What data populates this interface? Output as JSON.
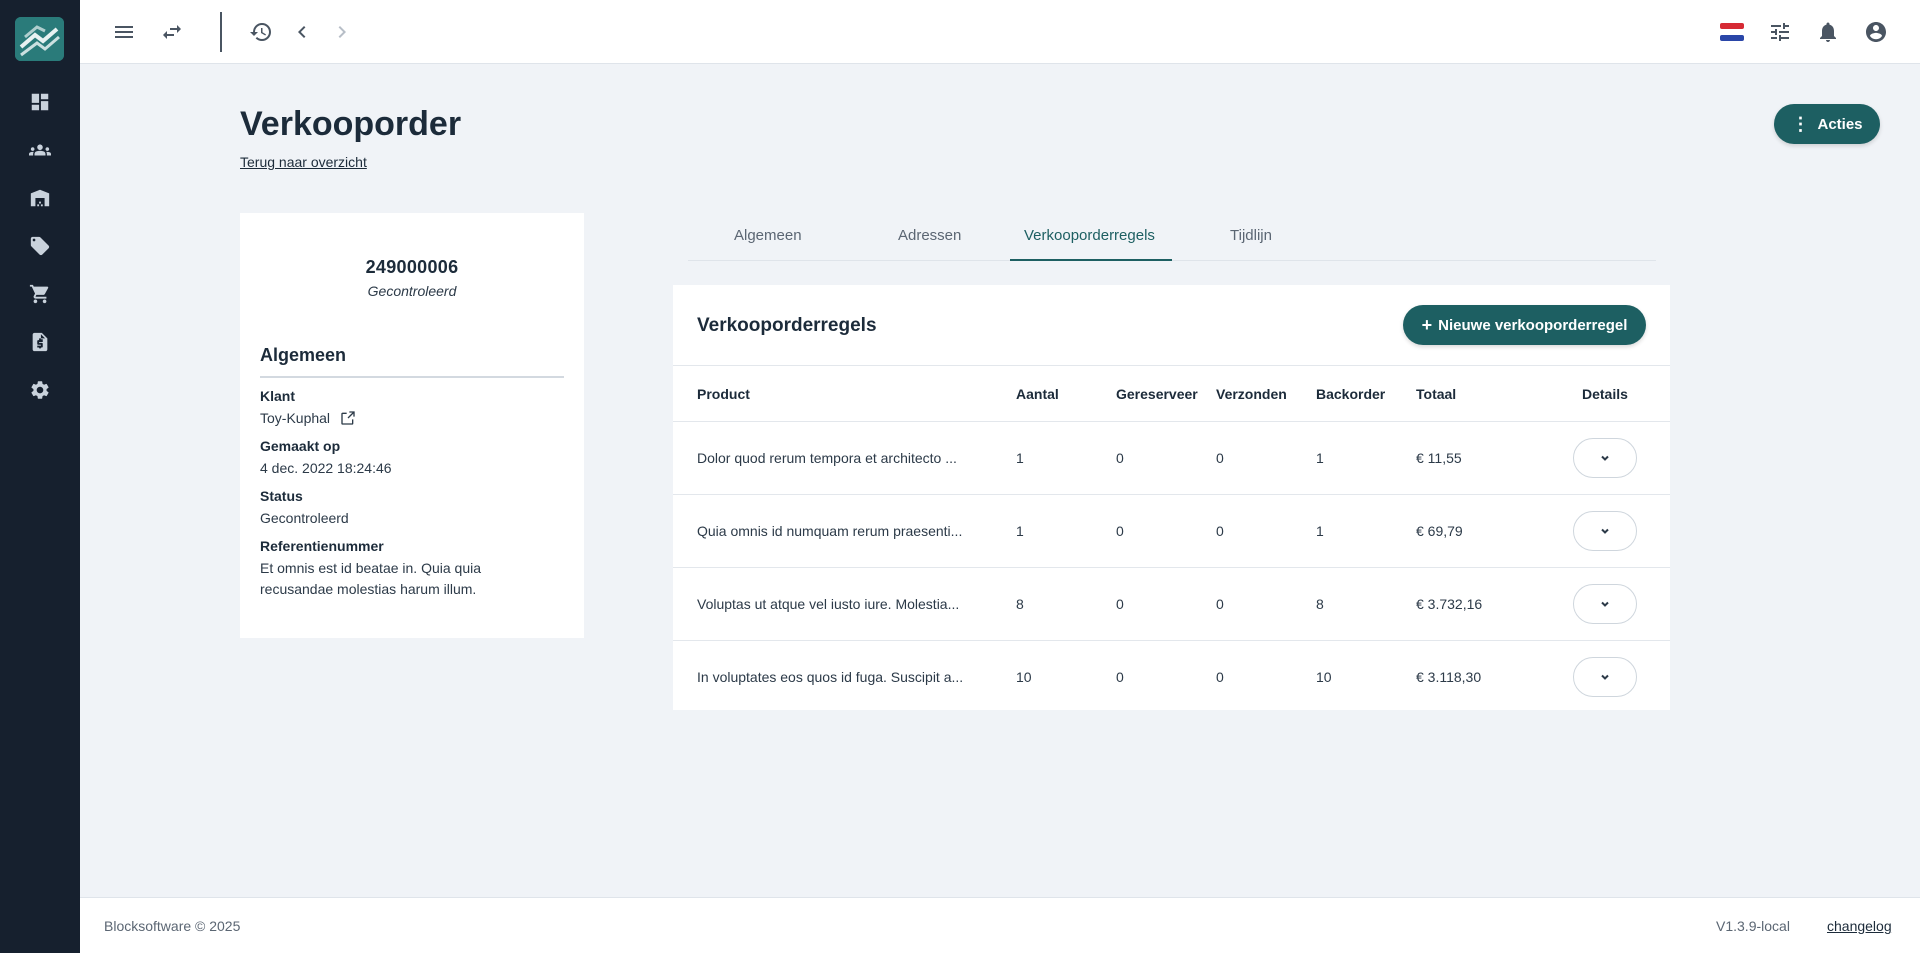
{
  "topbar": {
    "icons": [
      "menu-icon",
      "swap-icon",
      "history-icon",
      "chevron-left-icon",
      "chevron-right-icon",
      "flag-nl-icon",
      "tune-icon",
      "bell-icon",
      "account-icon"
    ]
  },
  "sidebar": {
    "items": [
      "dashboard-icon",
      "users-icon",
      "warehouse-icon",
      "tag-icon",
      "cart-icon",
      "invoice-icon",
      "settings-icon"
    ]
  },
  "header": {
    "title": "Verkooporder",
    "back_link": "Terug naar overzicht",
    "actions_label": "Acties"
  },
  "summary": {
    "order_number": "249000006",
    "status": "Gecontroleerd",
    "section_title": "Algemeen",
    "fields": [
      {
        "label": "Klant",
        "value": "Toy-Kuphal"
      },
      {
        "label": "Gemaakt op",
        "value": "4 dec. 2022 18:24:46"
      },
      {
        "label": "Status",
        "value": "Gecontroleerd"
      },
      {
        "label": "Referentienummer",
        "value": "Et omnis est id beatae in. Quia quia recusandae molestias harum illum."
      }
    ]
  },
  "tabs": [
    {
      "label": "Algemeen"
    },
    {
      "label": "Adressen"
    },
    {
      "label": "Verkooporderregels"
    },
    {
      "label": "Tijdlijn"
    }
  ],
  "lines": {
    "title": "Verkooporderregels",
    "new_button": "Nieuwe verkooporderregel",
    "columns": [
      "Product",
      "Aantal",
      "Gereserveer",
      "Verzonden",
      "Backorder",
      "Totaal",
      "Details"
    ],
    "rows": [
      {
        "product": "Dolor quod rerum tempora et architecto ...",
        "aantal": "1",
        "gereserveerd": "0",
        "verzonden": "0",
        "backorder": "1",
        "totaal": "€ 11,55"
      },
      {
        "product": "Quia omnis id numquam rerum praesenti...",
        "aantal": "1",
        "gereserveerd": "0",
        "verzonden": "0",
        "backorder": "1",
        "totaal": "€ 69,79"
      },
      {
        "product": "Voluptas ut atque vel iusto iure. Molestia...",
        "aantal": "8",
        "gereserveerd": "0",
        "verzonden": "0",
        "backorder": "8",
        "totaal": "€ 3.732,16"
      },
      {
        "product": "In voluptates eos quos id fuga. Suscipit a...",
        "aantal": "10",
        "gereserveerd": "0",
        "verzonden": "0",
        "backorder": "10",
        "totaal": "€ 3.118,30"
      }
    ]
  },
  "footer": {
    "copyright": "Blocksoftware © 2025",
    "version": "V1.3.9-local",
    "changelog": "changelog"
  },
  "colors": {
    "sidebar": "#16202e",
    "accent": "#1d5f62",
    "background": "#f0f3f7"
  }
}
